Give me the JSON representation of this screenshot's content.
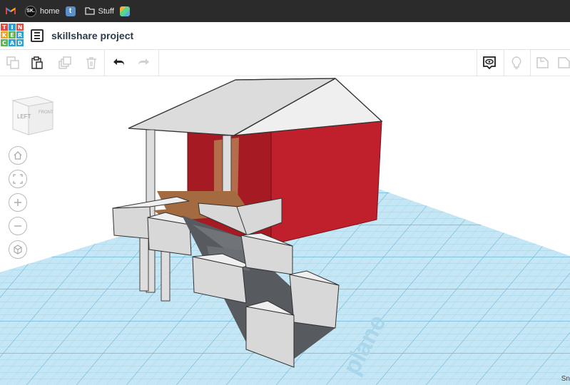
{
  "bookmarks": [
    {
      "label": "",
      "icon": "gmail-icon"
    },
    {
      "label": "home",
      "icon": "sk-icon",
      "icon_text": "SK."
    },
    {
      "label": "",
      "icon": "tumblr-icon",
      "icon_text": "t"
    },
    {
      "label": "Stuff",
      "icon": "folder-icon"
    },
    {
      "label": "",
      "icon": "app-grid-icon"
    }
  ],
  "logo": {
    "letters": [
      "T",
      "I",
      "N",
      "K",
      "E",
      "R",
      "C",
      "A",
      "D"
    ]
  },
  "project": {
    "title": "skillshare project"
  },
  "viewcube": {
    "left_face": "LEFT",
    "front_face": "FRONT"
  },
  "workplane": {
    "label": "plane"
  },
  "status": {
    "snap_label": "Sn"
  },
  "colors": {
    "accent_red": "#c01f2c",
    "workplane_blue": "#bfe3f2",
    "bookmark_bar": "#2b2b2b"
  }
}
